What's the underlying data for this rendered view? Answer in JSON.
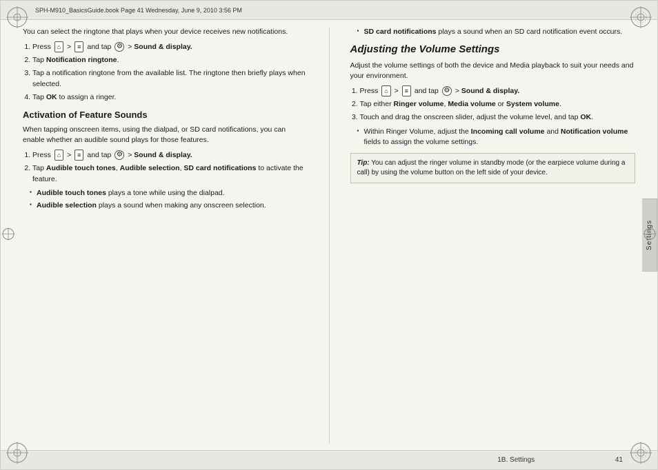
{
  "header": {
    "text": "SPH-M910_BasicsGuide.book  Page 41  Wednesday, June 9, 2010  3:56 PM"
  },
  "footer": {
    "section": "1B. Settings",
    "page": "41"
  },
  "side_tab": {
    "label": "Settings"
  },
  "left_column": {
    "intro_paragraph": "You can select the ringtone that plays when your device receives new notifications.",
    "steps_intro": [
      {
        "num": 1,
        "icon_home": "⌂",
        "icon_menu": "≡",
        "icon_gear": "⚙",
        "text_parts": [
          "Press",
          ">",
          "and tap",
          "> Sound & display."
        ]
      },
      {
        "num": 2,
        "text": "Tap Notification ringtone."
      },
      {
        "num": 3,
        "text": "Tap a notification ringtone from the available list. The ringtone then briefly plays when selected."
      },
      {
        "num": 4,
        "text": "Tap OK to assign a ringer."
      }
    ],
    "activation_heading": "Activation of Feature Sounds",
    "activation_paragraph": "When tapping onscreen items, using the dialpad, or SD card notifications, you can enable whether an audible sound plays for those features.",
    "activation_steps": [
      {
        "num": 1,
        "text_parts": [
          "Press",
          ">",
          "and tap",
          "> Sound & display."
        ]
      },
      {
        "num": 2,
        "text": "Tap Audible touch tones, Audible selection, SD card notifications to activate the feature."
      }
    ],
    "bullets": [
      {
        "bold_part": "Audible touch tones",
        "rest": " plays a tone while using the dialpad."
      },
      {
        "bold_part": "Audible selection",
        "rest": " plays a sound when making any onscreen selection."
      }
    ]
  },
  "right_column": {
    "sd_bullet": {
      "bold_part": "SD card notifications",
      "rest": " plays a sound when an SD card notification event occurs."
    },
    "adjusting_heading": "Adjusting the Volume Settings",
    "adjusting_paragraph": "Adjust the volume settings of both the device and Media playback to suit your needs and your environment.",
    "adjusting_steps": [
      {
        "num": 1,
        "text_parts": [
          "Press",
          ">",
          "and tap",
          "> Sound & display."
        ]
      },
      {
        "num": 2,
        "text": "Tap either Ringer volume, Media volume or System volume."
      },
      {
        "num": 3,
        "text": "Touch and drag the onscreen slider, adjust the volume level, and tap OK."
      }
    ],
    "sub_bullet": {
      "bold_part": "Within Ringer Volume",
      "rest": ", adjust the Incoming call volume and Notification volume fields to assign the volume settings."
    },
    "tip_box": {
      "label": "Tip:",
      "text": " You can adjust the ringer volume in standby mode (or the earpiece volume during a call) by using the volume button on the left side of your device."
    }
  }
}
